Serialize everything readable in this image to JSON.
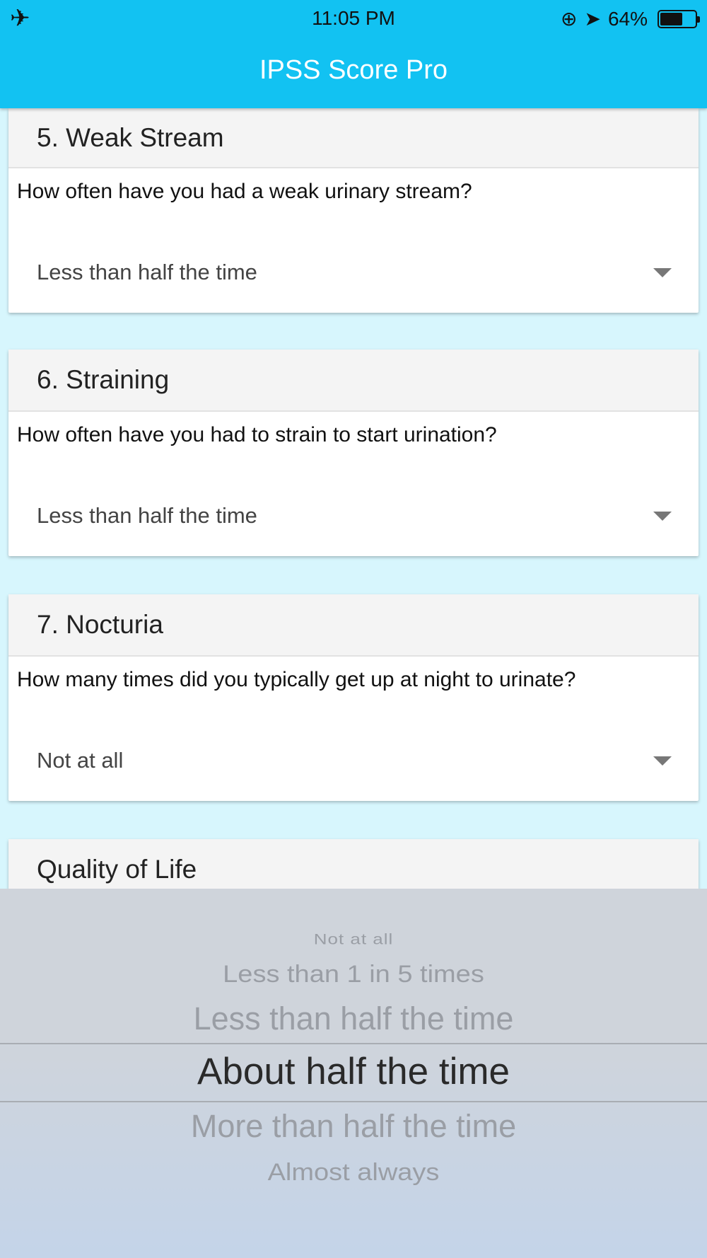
{
  "status_bar": {
    "time": "11:05 PM",
    "battery_text": "64%",
    "battery_level": 0.64
  },
  "nav": {
    "title": "IPSS Score Pro"
  },
  "questions": [
    {
      "heading": "5. Weak Stream",
      "prompt": "How often have you had a weak urinary stream?",
      "answer": "Less than half the time"
    },
    {
      "heading": "6. Straining",
      "prompt": "How often have you had to strain to start urination?",
      "answer": "Less than half the time"
    },
    {
      "heading": "7. Nocturia",
      "prompt": "How many times did you typically get up at night to urinate?",
      "answer": "Not at all"
    },
    {
      "heading": "Quality of Life"
    }
  ],
  "picker": {
    "options": [
      "Not at all",
      "Less than 1 in 5 times",
      "Less than half the time",
      "About half the time",
      "More than half the time",
      "Almost always"
    ],
    "selected": "About half the time"
  },
  "icons": {
    "status": [
      "airplane-icon",
      "rotation-lock-icon",
      "location-arrow-icon",
      "battery-icon"
    ],
    "select": "chevron-down-icon"
  },
  "colors": {
    "nav_bar": "#12c2f2",
    "page_background": "#d7f6fd",
    "card_header": "#f4f4f4"
  }
}
